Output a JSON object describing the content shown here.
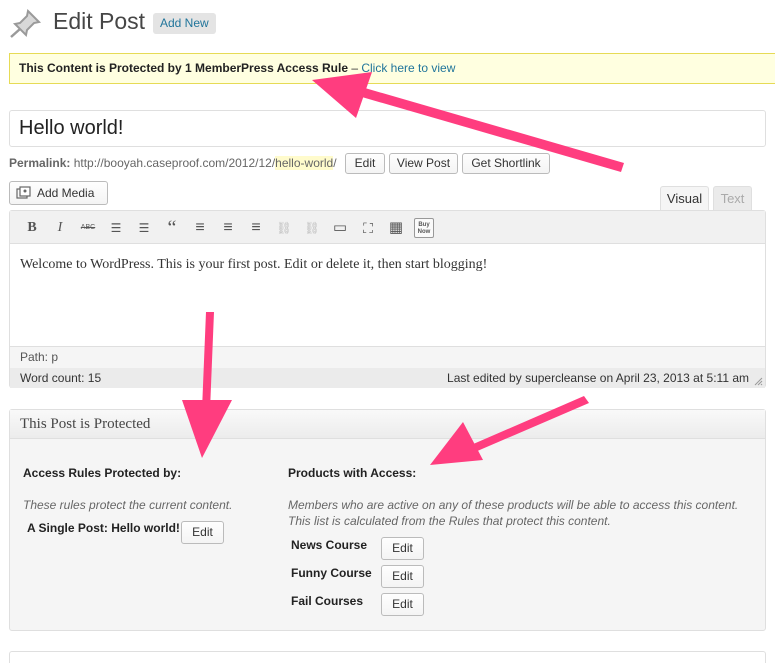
{
  "header": {
    "title": "Edit Post",
    "add_new_label": "Add New"
  },
  "notice": {
    "text": "This Content is Protected by 1 MemberPress Access Rule",
    "separator": " – ",
    "link": "Click here to view",
    "bg_color": "#ffffe0",
    "border_color": "#e6db55"
  },
  "post": {
    "title": "Hello world!",
    "permalink_label": "Permalink:",
    "permalink_base": "http://booyah.caseproof.com/2012/12/",
    "permalink_slug": "hello-world",
    "permalink_end": "/",
    "edit_label": "Edit",
    "view_post_label": "View Post",
    "get_shortlink_label": "Get Shortlink"
  },
  "editor": {
    "add_media_label": "Add Media",
    "tabs": [
      {
        "label": "Visual",
        "active": true
      },
      {
        "label": "Text",
        "active": false
      }
    ],
    "toolbar": [
      {
        "name": "bold-icon",
        "glyph": "B"
      },
      {
        "name": "italic-icon",
        "glyph": "I"
      },
      {
        "name": "strikethrough-icon",
        "glyph": "ABC"
      },
      {
        "name": "bullet-list-icon",
        "glyph": "☰"
      },
      {
        "name": "numbered-list-icon",
        "glyph": "☰"
      },
      {
        "name": "blockquote-icon",
        "glyph": "“"
      },
      {
        "name": "align-left-icon",
        "glyph": "≡"
      },
      {
        "name": "align-center-icon",
        "glyph": "≡"
      },
      {
        "name": "align-right-icon",
        "glyph": "≡"
      },
      {
        "name": "insert-link-icon",
        "glyph": "⛓"
      },
      {
        "name": "unlink-icon",
        "glyph": "⛓"
      },
      {
        "name": "more-tag-icon",
        "glyph": "▭"
      },
      {
        "name": "fullscreen-icon",
        "glyph": "⛶"
      },
      {
        "name": "kitchen-sink-icon",
        "glyph": "▦"
      },
      {
        "name": "buy-now-icon",
        "glyph": "Buy Now"
      }
    ],
    "content": "Welcome to WordPress. This is your first post. Edit or delete it, then start blogging!",
    "path": "Path: p",
    "word_count": "Word count: 15",
    "last_edited": "Last edited by supercleanse on April 23, 2013 at 5:11 am"
  },
  "protected_box": {
    "title": "This Post is Protected",
    "rules_heading": "Access Rules Protected by:",
    "rules_desc": "These rules protect the current content.",
    "rules": [
      {
        "name": "A Single Post: Hello world!",
        "edit_label": "Edit"
      }
    ],
    "products_heading": "Products with Access:",
    "products_desc_1": "Members who are active on any of these products will be able to access this content.",
    "products_desc_2": "This list is calculated from the Rules that protect this content.",
    "products": [
      {
        "name": "News Course",
        "edit_label": "Edit"
      },
      {
        "name": "Funny Course",
        "edit_label": "Edit"
      },
      {
        "name": "Fail Courses",
        "edit_label": "Edit"
      }
    ]
  },
  "colors": {
    "link": "#21759b",
    "arrow": "#ff3d7f"
  }
}
